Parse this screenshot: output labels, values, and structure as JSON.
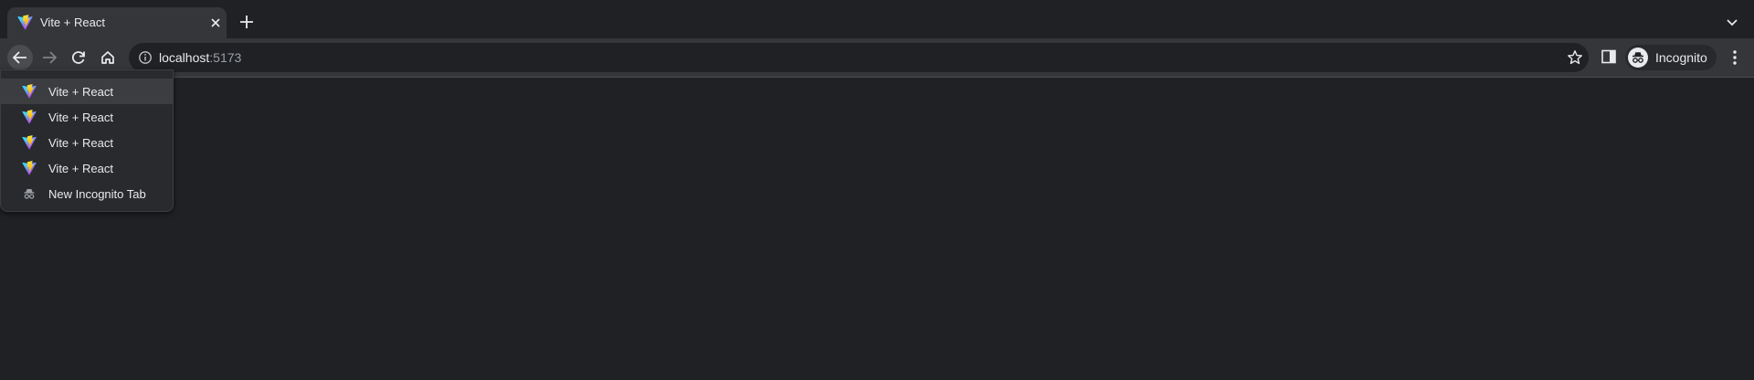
{
  "tab": {
    "title": "Vite + React",
    "favicon": "vite-logo-icon"
  },
  "toolbar": {
    "url_host": "localhost",
    "url_port": ":5173",
    "profile_label": "Incognito"
  },
  "history_menu": {
    "items": [
      {
        "label": "Vite + React",
        "icon": "vite-logo-icon"
      },
      {
        "label": "Vite + React",
        "icon": "vite-logo-icon"
      },
      {
        "label": "Vite + React",
        "icon": "vite-logo-icon"
      },
      {
        "label": "Vite + React",
        "icon": "vite-logo-icon"
      },
      {
        "label": "New Incognito Tab",
        "icon": "incognito-icon"
      }
    ]
  },
  "colors": {
    "page_background": "#202124",
    "toolbar_background": "#35363a",
    "text": "#e8eaed",
    "muted_text": "#9aa0a6"
  }
}
